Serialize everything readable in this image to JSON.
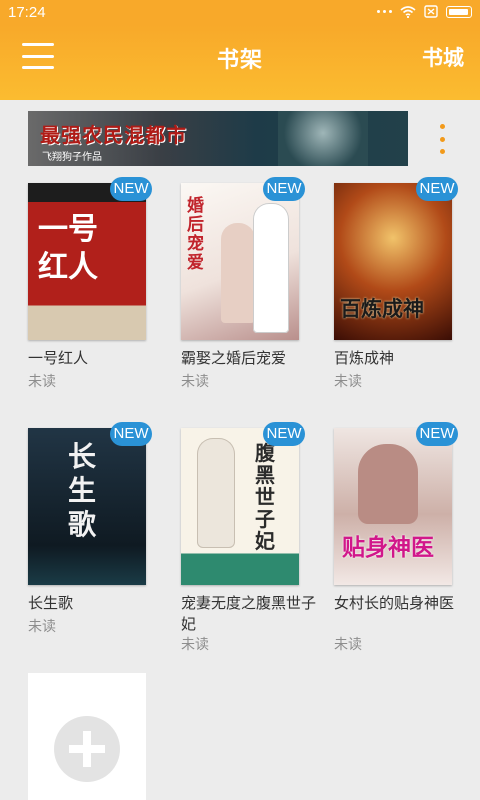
{
  "status": {
    "time": "17:24"
  },
  "appbar": {
    "title": "书架",
    "store": "书城"
  },
  "banner": {
    "text": "最强农民混都市",
    "author": "飞翔狗子作品"
  },
  "books": [
    {
      "title": "一号红人",
      "status": "未读",
      "badge": "NEW",
      "cover_text": "一号\n红人",
      "cover_color": "#b1201b"
    },
    {
      "title": "霸娶之婚后宠爱",
      "status": "未读",
      "badge": "NEW",
      "cover_text": "婚后宠爱",
      "cover_color": "#f3eee9"
    },
    {
      "title": "百炼成神",
      "status": "未读",
      "badge": "NEW",
      "cover_text": "百炼成神",
      "cover_color": "#8b3512"
    },
    {
      "title": "长生歌",
      "status": "未读",
      "badge": "NEW",
      "cover_text": "长生歌",
      "cover_color": "#14202a"
    },
    {
      "title": "宠妻无度之腹黑世子妃",
      "status": "未读",
      "badge": "NEW",
      "cover_text": "腹黑世子妃",
      "cover_color": "#f4eee2"
    },
    {
      "title": "女村长的贴身神医",
      "status": "未读",
      "badge": "NEW",
      "cover_text": "贴身神医",
      "cover_color": "#d9c3bd"
    }
  ]
}
